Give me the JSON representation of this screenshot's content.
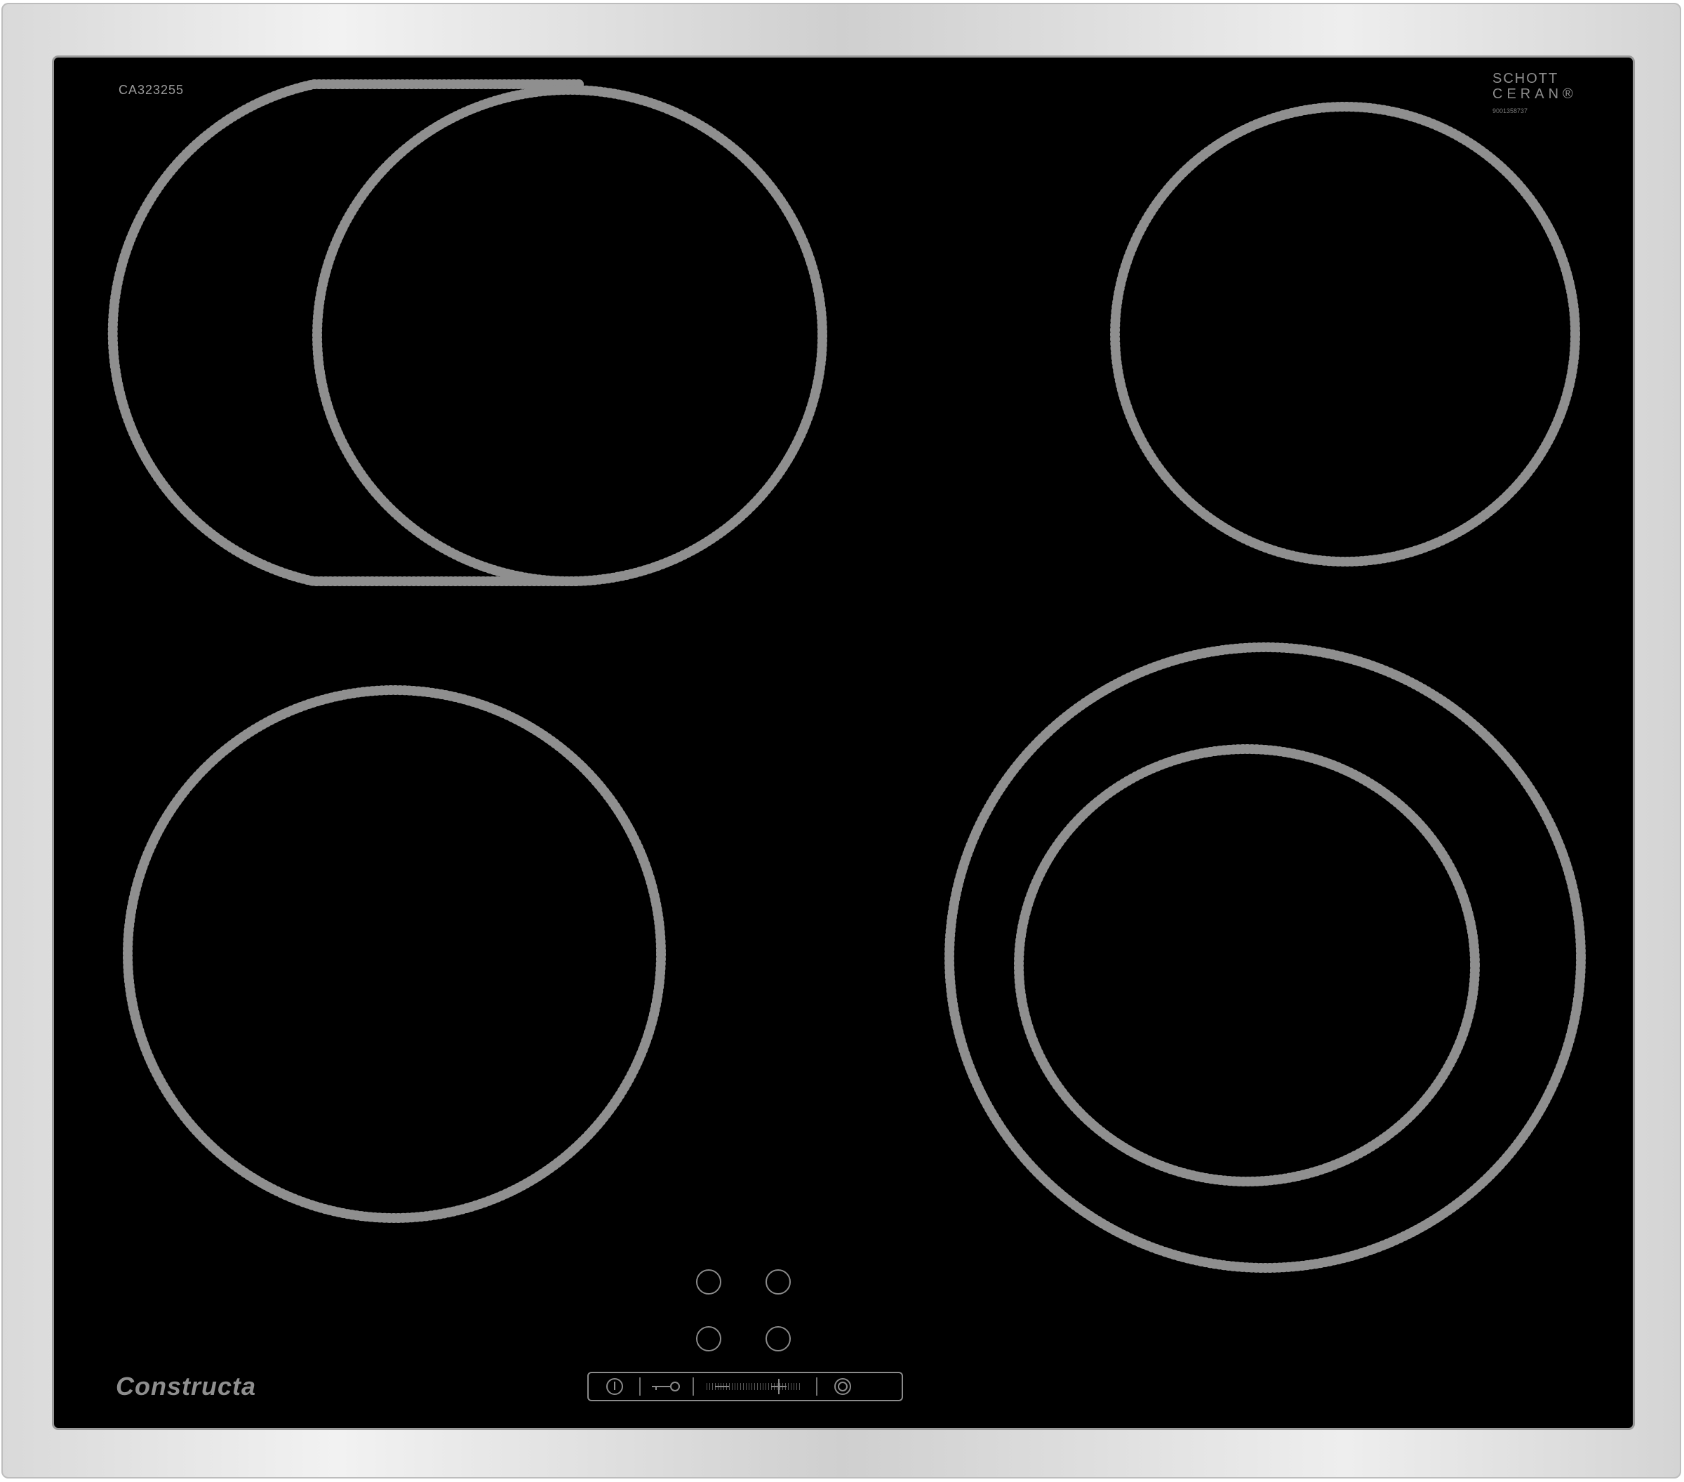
{
  "product": {
    "model_number": "CA323255",
    "glass_brand_line1": "SCHOTT",
    "glass_brand_line2": "CERAN",
    "glass_brand_mark": "®",
    "glass_serial": "9001358737",
    "manufacturer_logo": "Constructa"
  },
  "colors": {
    "glass": "#000000",
    "frame": "#d8d8d8",
    "zone_dots": "#8f8f8f"
  },
  "cooking_zones": [
    {
      "name": "back-left-oval-zone"
    },
    {
      "name": "back-right-zone"
    },
    {
      "name": "front-left-zone"
    },
    {
      "name": "front-right-dual-zone"
    }
  ],
  "controls": {
    "power_icon": "power-icon",
    "lock_icon": "key-lock-icon",
    "minus_icon": "minus-icon",
    "plus_icon": "plus-icon",
    "zone_select_icon": "zone-select-icon"
  }
}
